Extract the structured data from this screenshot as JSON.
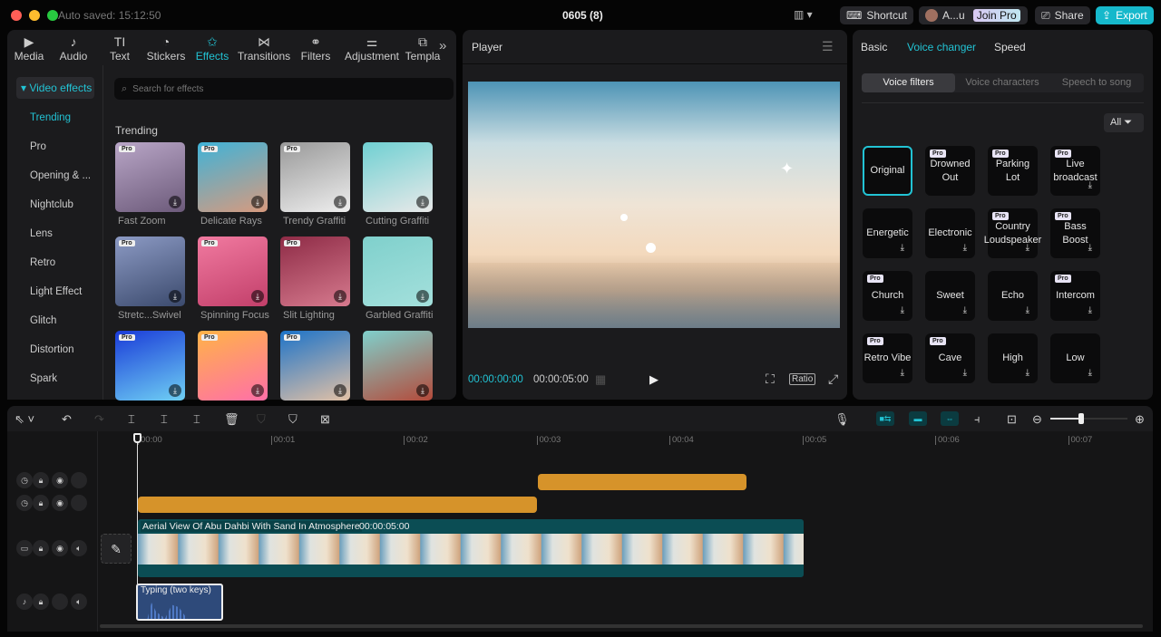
{
  "app": {
    "autosave": "Auto saved: 15:12:50",
    "title": "0605 (8)",
    "shortcut": "Shortcut",
    "user": "A...u",
    "join_pro": "Join Pro",
    "share": "Share",
    "export": "Export",
    "accent": "#22c3d4"
  },
  "tabs": [
    {
      "label": "Media",
      "icon": "▶"
    },
    {
      "label": "Audio",
      "icon": "♪"
    },
    {
      "label": "Text",
      "icon": "TI"
    },
    {
      "label": "Stickers",
      "icon": "◔"
    },
    {
      "label": "Effects",
      "icon": "✩",
      "active": true
    },
    {
      "label": "Transitions",
      "icon": "⋈"
    },
    {
      "label": "Filters",
      "icon": "⚭"
    },
    {
      "label": "Adjustment",
      "icon": "⚌"
    },
    {
      "label": "Templa",
      "icon": "⧉"
    }
  ],
  "more_tabs": "»",
  "effects": {
    "section": "▾ Video effects",
    "categories": [
      "Trending",
      "Pro",
      "Opening & ...",
      "Nightclub",
      "Lens",
      "Retro",
      "Light Effect",
      "Glitch",
      "Distortion",
      "Spark"
    ],
    "search_placeholder": "Search for effects",
    "heading": "Trending",
    "items": [
      {
        "label": "Fast Zoom",
        "pro": "Pro",
        "c": "#b9a6c7,#6c5a7a"
      },
      {
        "label": "Delicate Rays",
        "pro": "Pro",
        "c": "#3fb3d8,#d89a7e"
      },
      {
        "label": "Trendy Graffiti",
        "pro": "Pro",
        "c": "#999,#eee"
      },
      {
        "label": "Cutting Graffiti",
        "pro": "",
        "c": "#6fd0d2,#e9e9e9"
      },
      {
        "label": "Stretc...Swivel",
        "pro": "Pro",
        "c": "#8c9ac4,#3b4a6d"
      },
      {
        "label": "Spinning Focus",
        "pro": "Pro",
        "c": "#f17aa0,#c23f6a"
      },
      {
        "label": "Slit Lighting",
        "pro": "Pro",
        "c": "#8e2b46,#d67a8e"
      },
      {
        "label": "Garbled Graffiti",
        "pro": "",
        "c": "#7fd0cc,#a4e0dc"
      },
      {
        "label": "",
        "pro": "Pro",
        "c": "#1a3bd8,#6fd0f4"
      },
      {
        "label": "",
        "pro": "Pro",
        "c": "#ffb347,#ff6fa8"
      },
      {
        "label": "",
        "pro": "Pro",
        "c": "#1d73c8,#e2c1a6"
      },
      {
        "label": "",
        "pro": "",
        "c": "#7fd0cc,#b44a3a"
      }
    ]
  },
  "player": {
    "title": "Player",
    "current": "00:00:00:00",
    "duration": "00:00:05:00",
    "ratio": "Ratio"
  },
  "right": {
    "tabs": [
      "Basic",
      "Voice changer",
      "Speed"
    ],
    "subtabs": [
      "Voice filters",
      "Voice characters",
      "Speech to song"
    ],
    "filter": "All",
    "tiles": [
      {
        "label": "Original",
        "sel": true,
        "pro": "",
        "dl": false
      },
      {
        "label": "Drowned Out",
        "pro": "Pro",
        "dl": false
      },
      {
        "label": "Parking Lot",
        "pro": "Pro",
        "dl": false
      },
      {
        "label": "Live broadcast",
        "pro": "Pro",
        "dl": true
      },
      {
        "label": "Energetic",
        "pro": "",
        "dl": true
      },
      {
        "label": "Electronic",
        "pro": "",
        "dl": true
      },
      {
        "label": "Country Loudspeaker",
        "pro": "Pro",
        "dl": true
      },
      {
        "label": "Bass Boost",
        "pro": "Pro",
        "dl": true
      },
      {
        "label": "Church",
        "pro": "Pro",
        "dl": true
      },
      {
        "label": "Sweet",
        "pro": "",
        "dl": true
      },
      {
        "label": "Echo",
        "pro": "",
        "dl": true
      },
      {
        "label": "Intercom",
        "pro": "Pro",
        "dl": true
      },
      {
        "label": "Retro Vibe",
        "pro": "Pro",
        "dl": true
      },
      {
        "label": "Cave",
        "pro": "Pro",
        "dl": true
      },
      {
        "label": "High",
        "pro": "",
        "dl": true
      },
      {
        "label": "Low",
        "pro": "",
        "dl": true
      }
    ]
  },
  "timeline": {
    "ticks": [
      "00:00",
      "00:01",
      "00:02",
      "00:03",
      "00:04",
      "00:05",
      "00:06",
      "00:07"
    ],
    "video_clip": {
      "title": "Aerial View Of Abu Dahbi With Sand In Atmosphere",
      "duration": "00:00:05:00"
    },
    "audio_clip": {
      "title": "Typing (two keys)"
    },
    "zoom_level": 0.4
  }
}
